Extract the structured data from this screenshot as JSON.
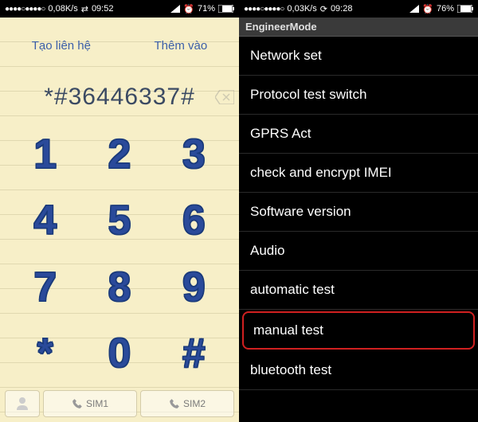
{
  "left": {
    "status": {
      "dots": "●●●●○●●●●○",
      "speed": "0,08K/s",
      "dual": "⇄",
      "time": "09:52",
      "battery_pct": "71%"
    },
    "top": {
      "create": "Tạo liên hệ",
      "add": "Thêm vào"
    },
    "display": "*#36446337#",
    "keys": [
      "1",
      "2",
      "3",
      "4",
      "5",
      "6",
      "7",
      "8",
      "9",
      "*",
      "0",
      "#"
    ],
    "bottom": {
      "sim1": "SIM1",
      "sim2": "SIM2"
    }
  },
  "right": {
    "status": {
      "dots": "●●●●○●●●●○",
      "speed": "0,03K/s",
      "sync": "⟳",
      "time": "09:28",
      "battery_pct": "76%"
    },
    "header": "EngineerMode",
    "items": [
      "Network set",
      "Protocol test switch",
      "GPRS Act",
      "check and encrypt IMEI",
      "Software version",
      "Audio",
      "automatic test",
      "manual test",
      "bluetooth test"
    ],
    "highlight_index": 7
  }
}
